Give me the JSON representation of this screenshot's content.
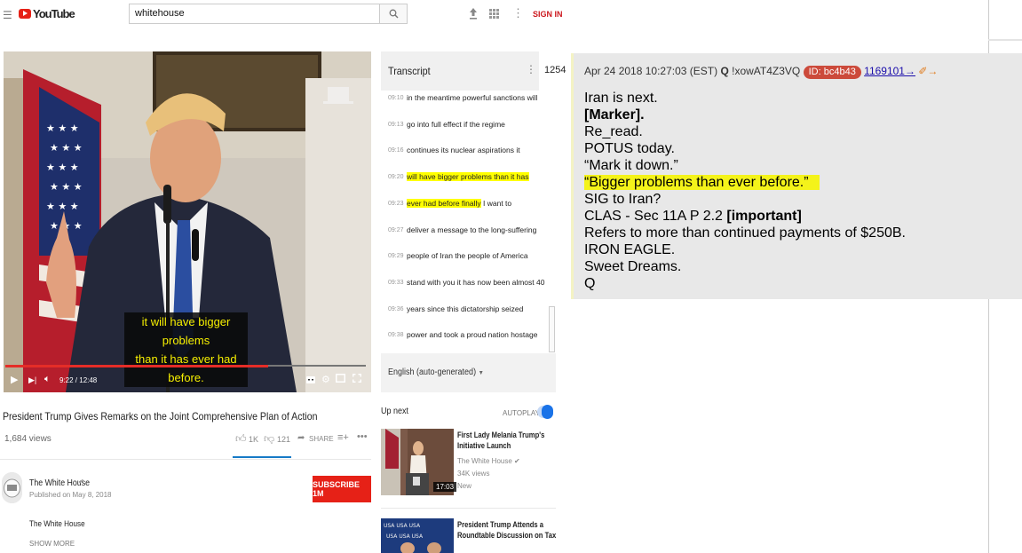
{
  "youtube": {
    "logo_text": "YouTube",
    "search_value": "whitehouse",
    "signin": "SIGN IN",
    "icons": [
      "menu-icon",
      "search-icon",
      "upload-icon",
      "apps-icon",
      "more-vert-icon"
    ]
  },
  "video": {
    "caption_line1": "it will have bigger problems",
    "caption_line2": "than it has ever had before.",
    "time": "9:22 / 12:48",
    "progress_fraction": 0.73,
    "title": "President Trump Gives Remarks on the Joint Comprehensive Plan of Action",
    "views": "1,684 views",
    "likes": "1K",
    "dislikes": "121",
    "share": "SHARE"
  },
  "channel": {
    "name": "The White House",
    "published": "Published on May 8, 2018",
    "subscribe": "SUBSCRIBE 1M",
    "description": "The White House",
    "show_more": "SHOW MORE"
  },
  "transcript": {
    "title": "Transcript",
    "rows": [
      {
        "time": "09:10",
        "text": "in the meantime powerful sanctions will"
      },
      {
        "time": "09:13",
        "text": "go into full effect if the regime"
      },
      {
        "time": "09:16",
        "text": "continues its nuclear aspirations it"
      },
      {
        "time": "09:20",
        "text": "will have bigger problems than it has"
      },
      {
        "time": "09:23",
        "text": "ever had before finally",
        "text_rest": " I want to"
      },
      {
        "time": "09:27",
        "text": "deliver a message to the long-suffering"
      },
      {
        "time": "09:29",
        "text": "people of Iran the people of America"
      },
      {
        "time": "09:33",
        "text": "stand with you it has now been almost 40"
      },
      {
        "time": "09:36",
        "text": "years since this dictatorship seized"
      },
      {
        "time": "09:38",
        "text": "power and took a proud nation hostage"
      }
    ],
    "language": "English (auto-generated)"
  },
  "up_next": {
    "label": "Up next",
    "autoplay": "AUTOPLAY",
    "items": [
      {
        "title_line1": "First Lady Melania Trump's",
        "title_line2": "Initiative Launch",
        "channel": "The White House",
        "views": "34K views",
        "badge": "New",
        "duration": "17:03"
      },
      {
        "title_line1": "President Trump Attends a",
        "title_line2": "Roundtable Discussion on Tax"
      }
    ]
  },
  "post": {
    "number": "1254",
    "date": "Apr 24 2018 10:27:03 (EST)",
    "name": "Q",
    "trip": "!xowAT4Z3VQ",
    "id": "ID: bc4b43",
    "link": "1169101→",
    "lines": [
      "Iran is next.",
      "[Marker].",
      "Re_read.",
      "POTUS today.",
      "“Mark it down.”",
      "“Bigger problems than ever before.”",
      "SIG to Iran?",
      "CLAS - Sec 11A P 2.2 ",
      "[important]",
      "Refers to more than continued payments of $250B.",
      "IRON EAGLE.",
      "Sweet Dreams.",
      "Q"
    ]
  }
}
